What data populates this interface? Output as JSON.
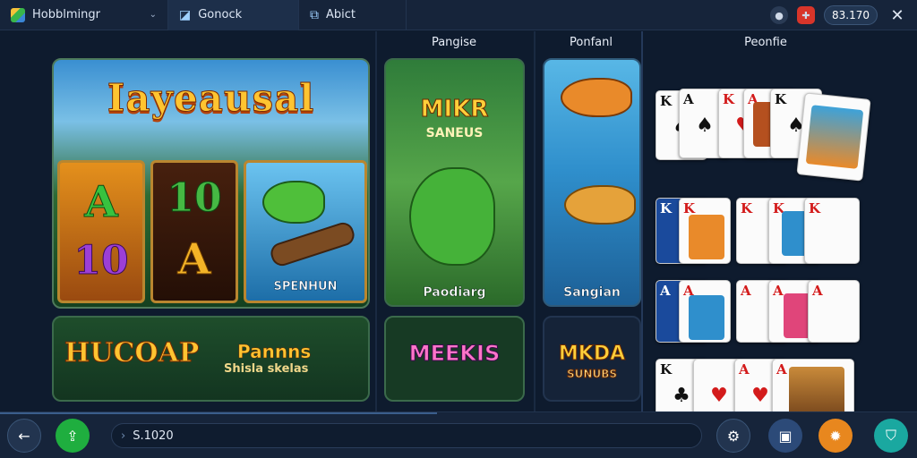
{
  "topbar": {
    "app_tab": "Hobblmingr",
    "tab2": "Gonock",
    "tab3": "Abict",
    "balance": "83.170"
  },
  "columns": {
    "col2_title": "Pangise",
    "col3_title": "Ponfanl",
    "col4_title": "Peonfie"
  },
  "hero": {
    "title": "Iayeausal",
    "reel_symbols": [
      "A",
      "10",
      "10",
      "A"
    ],
    "spin_label": "SPENHUN"
  },
  "banner": {
    "big": "HUCOAP",
    "side": "Pannns",
    "sub": "Shisla skelas"
  },
  "tile2": {
    "title": "MIKR",
    "subtitle": "SANEUS",
    "bottom_label": "Paodiarg",
    "banner": "MEEKIS"
  },
  "tile3": {
    "bottom_label": "Sangian",
    "banner": "MKDA",
    "banner_sub": "SUNUBS"
  },
  "cards": {
    "row1": [
      {
        "rank": "K",
        "suit": "♠"
      },
      {
        "rank": "A",
        "suit": "♠"
      },
      {
        "rank": "K",
        "suit": "♥"
      },
      {
        "rank": "A",
        "suit": "♥"
      },
      {
        "rank": "K",
        "suit": "♠"
      }
    ],
    "row2": [
      {
        "rank": "K",
        "suit": "♦"
      },
      {
        "rank": "K",
        "suit": "♦"
      },
      {
        "rank": "K",
        "suit": "♥"
      },
      {
        "rank": "K",
        "suit": "♦"
      }
    ],
    "row3": [
      {
        "rank": "A",
        "suit": "♥"
      },
      {
        "rank": "A",
        "suit": "♥"
      },
      {
        "rank": "A",
        "suit": "♥"
      },
      {
        "rank": "A",
        "suit": "♥"
      }
    ],
    "row4": [
      {
        "rank": "K",
        "suit": "♣"
      },
      {
        "rank": "A",
        "suit": "♥"
      },
      {
        "rank": "A",
        "suit": "♠"
      },
      {
        "rank": "A",
        "suit": "♥"
      }
    ]
  },
  "bottombar": {
    "field_value": "S.1020"
  },
  "icons": [
    "stack-app-icon",
    "chevron-down-icon",
    "image-icon",
    "camera-icon",
    "record-icon",
    "gift-icon",
    "close-icon",
    "back-icon",
    "share-icon",
    "chevron-right-icon",
    "gear-icon",
    "grid-icon",
    "orange-gear-icon",
    "shield-icon"
  ],
  "colors": {
    "accent_green": "#1fae3f",
    "accent_orange": "#e8871e",
    "accent_teal": "#1aa8a0",
    "gold": "#ffc431"
  }
}
